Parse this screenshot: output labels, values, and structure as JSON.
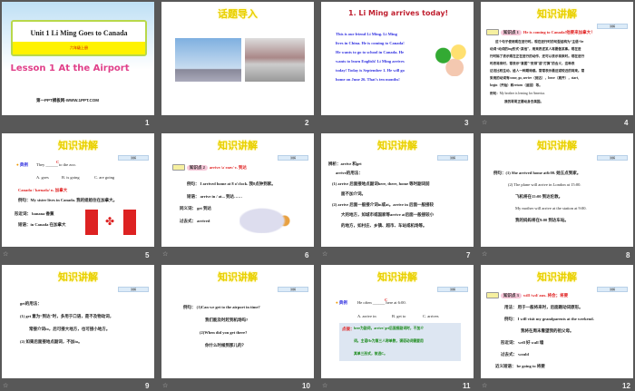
{
  "slides": [
    {
      "number": "1",
      "title": "Unit 1 Li Ming Goes to Canada",
      "grade": "六年级上册",
      "lesson": "Lesson 1 At the Airport",
      "footer": "第一PPT模板网-WWW.1PPT.COM"
    },
    {
      "number": "2",
      "title": "话题导入"
    },
    {
      "number": "3",
      "title": "1. Li Ming arrives today!",
      "lines": [
        "This is our friend Li Ming. Li Ming",
        "lives in China. He is coming to Canada!",
        "He wants to go to school in Canada. He",
        "wants to learn English! Li Ming arrives",
        "today! Today is September 1. He will go",
        "home on June 26. That's ten months!"
      ]
    },
    {
      "number": "4",
      "title": "知识讲解",
      "tag": "讲解",
      "kp_label": "知识点 1",
      "kp_text": "He is coming to Canada!他要来加拿大！",
      "lines": [
        "这个句子使用现在进行时。现在进行时的句型结构为“主语+be",
        "动词+动词的ing形式+其他”，用来表述某人将要做某事。现在进",
        "行时除了表示现在正在进行的动作，还可以表示将来时。现在进行",
        "时表将来时，常表示“意图”“安排”或“打算”的含义，这种表",
        "达法比较生动，给人一种期待感。常常表示最近或较近的将来。常",
        "采用的动词有come, go, arrive（到达），leave（离开），start,",
        "begin（开始）和return（返回）等。"
      ],
      "example_label": "例句：",
      "example": "My brother is leaving for America.",
      "example_cn": "我的哥哥正要动身去美国。"
    },
    {
      "number": "5",
      "title": "知识讲解",
      "tag": "讲解",
      "dianli": "典例",
      "q": "They ______ to the zoo.",
      "answer": "C",
      "options": [
        "A. goes",
        "B. is going",
        "C. are going"
      ],
      "word": "Canada /ˈkænədə/ n. 加拿大",
      "ex": "例句：My sister lives in Canada. 我的姐姐住在加拿大。",
      "sim": "形近词：  banana 香蕉",
      "phrase": "短语：in Canada 在加拿大"
    },
    {
      "number": "6",
      "title": "知识讲解",
      "tag": "讲解",
      "kp_label": "知识点 2",
      "kp_text": "arrive /əˈraɪv/ v. 到达",
      "lines": [
        "例句：  I arrived  home at 8 o'clock. 我8点钟到家。",
        "短语：  arrive in / at...  到达……",
        "同义词：  get 到达",
        "过去式：  arrived"
      ]
    },
    {
      "number": "7",
      "title": "知识讲解",
      "tag": "讲解",
      "lines": [
        "辨析：arrive 和get",
        "arrive的用法：",
        "(1) arrive 后面接地点副词here, there,  home 等时副词前",
        "面不加介词。",
        "(2) arrive 后面一般接介词in或at。arrive in 后面一般接较",
        "大的地方，如城市或国家等arrive at后面一般接较小",
        "的地方，如村庄、乡镇、超市、车站或机场等。"
      ]
    },
    {
      "number": "8",
      "title": "知识讲解",
      "tag": "讲解",
      "lines": [
        "例句：(1) She arrived home at6:00. 她五点到家。",
        "(2) The plane will arrive  in London at 15:00.",
        "飞机将在15:00 到达伦敦。",
        "My mother will arrive  at the station at 9:00.",
        "我的妈妈将在9:00 到达车站。"
      ]
    },
    {
      "number": "9",
      "title": "知识讲解",
      "tag": "讲解",
      "lines": [
        "get的用法：",
        "(1) get 意为“到达”时，多用于口语，是不及物动词，",
        "常接介词to，后可接大地方，也可接小地方。",
        "(2) 如果后面接地点副词，不加to。"
      ]
    },
    {
      "number": "10",
      "title": "知识讲解",
      "tag": "讲解",
      "lines": [
        "例句：  (1)Can we get to the airport in time?",
        "我们能及时赶到机场吗?",
        "(2)When did you get there?",
        "你什么时候到那儿的？"
      ]
    },
    {
      "number": "11",
      "title": "知识讲解",
      "tag": "讲解",
      "dianli": "典例",
      "q": "He often ______ here at 6:00.",
      "answer": "C",
      "options": [
        "A. arrive  in",
        "B. get to",
        "C. arrives"
      ],
      "tip_label": "点拨：",
      "tip": [
        "here为副词，arrive/ get后面接副词时，不加介",
        "词。主语He为第三人称单数，谓语动词需要用",
        "其单三形式，故选C。"
      ]
    },
    {
      "number": "12",
      "title": "知识讲解",
      "tag": "讲解",
      "kp_label": "知识点 3",
      "kp_text": "will /wɪl/ aux. 将会；将要",
      "lines": [
        "用法：  用于一般将来时，后面跟动词原形。",
        "例句：  I will visit my grandparents at the weekend.",
        "我将在周末看望我的祖父母。",
        "形近词：  well 好  wall 墙",
        "过去式：  would",
        "近义短语：  be going to 将要"
      ]
    }
  ],
  "colors": {
    "background": "#585858",
    "title_yellow": "#e8d000",
    "red": "#e02020",
    "blue": "#3030e0"
  }
}
